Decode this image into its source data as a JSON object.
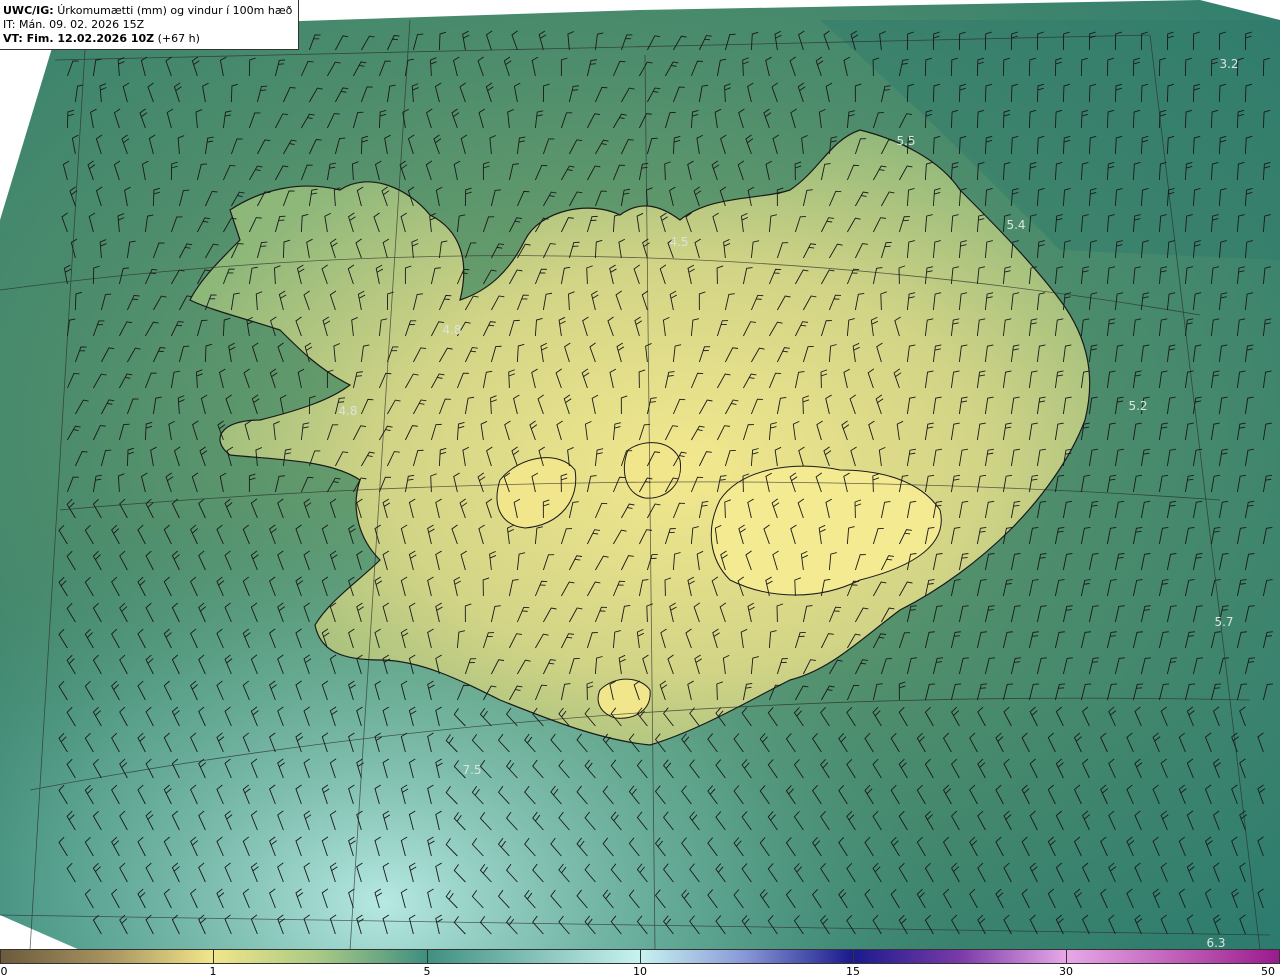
{
  "header": {
    "model_prefix": "UWC/IG:",
    "title": "Úrkomumætti (mm) og vindur í 100m hæð",
    "init_time": "IT: Mán. 09. 02. 2026 15Z",
    "valid_prefix": "VT: Fim. 12.02.2026 10Z",
    "valid_suffix": "(+67 h)"
  },
  "map_labels": [
    "3.2",
    "5.5",
    "5.4",
    "4.5",
    "4.8",
    "4.8",
    "5.2",
    "5.7",
    "7.5",
    "6.3"
  ],
  "colorbar": {
    "ticks": [
      "0",
      "1",
      "5",
      "10",
      "15",
      "30",
      "50"
    ],
    "colors": [
      "#6b5a3c",
      "#b8a46a",
      "#f2e68a",
      "#8fbf86",
      "#3f8f80",
      "#bff0ee",
      "#1a1a8c",
      "#e8a8e8",
      "#9a1a8c"
    ]
  },
  "colors": {
    "ocean": "#2f7f6e",
    "land_low": "#f0e58a",
    "land_mid": "#8fbd78",
    "coast": "#1a1a1a"
  }
}
